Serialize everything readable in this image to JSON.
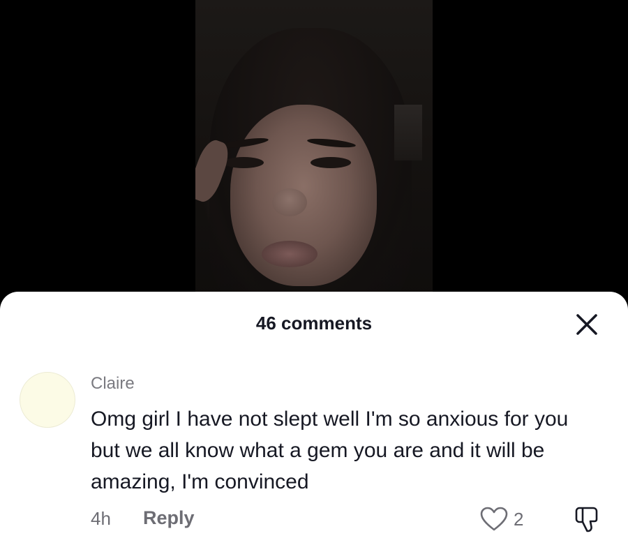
{
  "video": {
    "description_hidden": ""
  },
  "sheet": {
    "title": "46 comments",
    "close_icon": "close-icon"
  },
  "comment": {
    "username": "Claire",
    "text": "Omg girl I have not slept well I'm so anxious for you but we all know what a gem you are and it will be amazing, I'm convinced",
    "time": "4h",
    "reply_label": "Reply",
    "like_count": "2",
    "like_icon": "heart-outline-icon",
    "dislike_icon": "thumbs-down-icon",
    "avatar_color": "#fcfbe6"
  },
  "colors": {
    "text_primary": "#161823",
    "text_secondary": "#6d6d74",
    "sheet_bg": "#ffffff",
    "backdrop": "#000000"
  }
}
